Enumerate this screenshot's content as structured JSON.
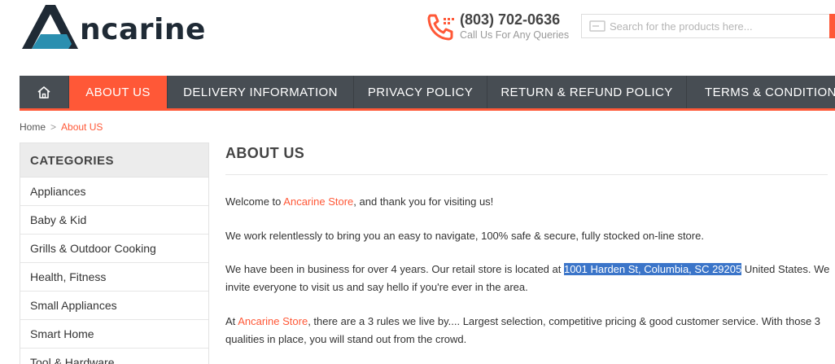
{
  "brand": {
    "logo_text": "ncarine",
    "colors": {
      "accent": "#ff5837",
      "dark": "#1f2a35",
      "teal": "#2a8fb0",
      "nav_bg": "#474d53"
    }
  },
  "header": {
    "phone_icon": "phone-icon",
    "phone_number": "(803) 702-0636",
    "phone_sub": "Call Us For Any Queries",
    "search_icon": "search-icon",
    "search_placeholder": "Search for the products here..."
  },
  "nav": {
    "home_icon": "home-icon",
    "items": [
      {
        "label": "ABOUT US",
        "active": true
      },
      {
        "label": "DELIVERY INFORMATION",
        "active": false
      },
      {
        "label": "PRIVACY POLICY",
        "active": false
      },
      {
        "label": "RETURN & REFUND POLICY",
        "active": false
      },
      {
        "label": "TERMS & CONDITION",
        "active": false
      }
    ]
  },
  "breadcrumb": {
    "home": "Home",
    "separator": ">",
    "current": "About US"
  },
  "sidebar": {
    "title": "CATEGORIES",
    "items": [
      "Appliances",
      "Baby & Kid",
      "Grills & Outdoor Cooking",
      "Health, Fitness",
      "Small Appliances",
      "Smart Home",
      "Tool & Hardware"
    ]
  },
  "main": {
    "title": "ABOUT US",
    "p1": {
      "a": "Welcome to ",
      "link": "Ancarine Store",
      "b": ", and thank you for visiting us!"
    },
    "p2": "We work relentlessly to bring you an easy to navigate, 100% safe & secure, fully stocked on-line store.",
    "p3": {
      "a": "We have been in business for over 4 years. Our retail store is located at ",
      "address": "1001 Harden St, Columbia, SC 29205",
      "b": " United States. We invite everyone to visit us and say hello if you're ever in the area."
    },
    "p4": {
      "a": "At ",
      "link": "Ancarine Store",
      "b": ", there are a 3 rules we live by.... Largest selection, competitive pricing & good customer service. With those 3 qualities in place, you will stand out from the crowd."
    }
  }
}
